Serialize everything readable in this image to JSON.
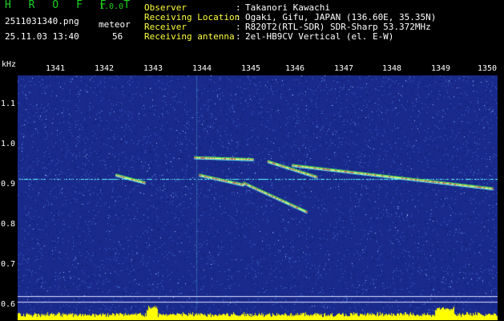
{
  "header": {
    "app_title": "H R O F F T",
    "app_version": "1.0.0",
    "file_name": "2511031340.png",
    "date_time": "25.11.03 13:40",
    "meteor_label": "meteor",
    "meteor_count": "56"
  },
  "station_info": [
    {
      "key": "Observer",
      "value": "Takanori Kawachi"
    },
    {
      "key": "Receiving Location",
      "value": "Ogaki, Gifu, JAPAN (136.60E, 35.35N)"
    },
    {
      "key": "Receiver",
      "value": "R820T2(RTL-SDR) SDR-Sharp 53.372MHz"
    },
    {
      "key": "Receiving antenna",
      "value": "2el-HB9CV Vertical (el. E-W)"
    }
  ],
  "colon": ":",
  "chart_data": {
    "type": "heatmap",
    "ylabel": "kHz",
    "x_ticks": [
      "1341",
      "1342",
      "1343",
      "1344",
      "1345",
      "1346",
      "1347",
      "1348",
      "1349",
      "1350"
    ],
    "y_ticks": [
      "1.1",
      "1.0",
      "0.9",
      "0.8",
      "0.7",
      "0.6"
    ],
    "ylim": [
      0.58,
      1.18
    ],
    "xlim": [
      1340.6,
      1350.4
    ],
    "carrier_khz": 0.913,
    "echo_traces": [
      {
        "x": [
          1342.6,
          1343.2
        ],
        "y": [
          0.925,
          0.905
        ]
      },
      {
        "x": [
          1344.3,
          1345.2
        ],
        "y": [
          0.925,
          0.9
        ]
      },
      {
        "x": [
          1345.2,
          1346.5
        ],
        "y": [
          0.905,
          0.83
        ]
      },
      {
        "x": [
          1345.7,
          1346.7
        ],
        "y": [
          0.96,
          0.92
        ]
      },
      {
        "x": [
          1346.2,
          1350.3
        ],
        "y": [
          0.95,
          0.89
        ]
      },
      {
        "x": [
          1344.2,
          1345.4
        ],
        "y": [
          0.97,
          0.965
        ]
      }
    ],
    "colors": {
      "background": "#1a2a8c",
      "noise_low": "#0a1a6a",
      "noise_mid": "#3f6fd0",
      "noise_high": "#a0c8ff",
      "carrier": "#60ffff",
      "echo_core": "#ff4040",
      "echo_edge": "#40ff60",
      "signal_bars": "#ffff00",
      "reference_lines": "#e0e0ff"
    }
  }
}
